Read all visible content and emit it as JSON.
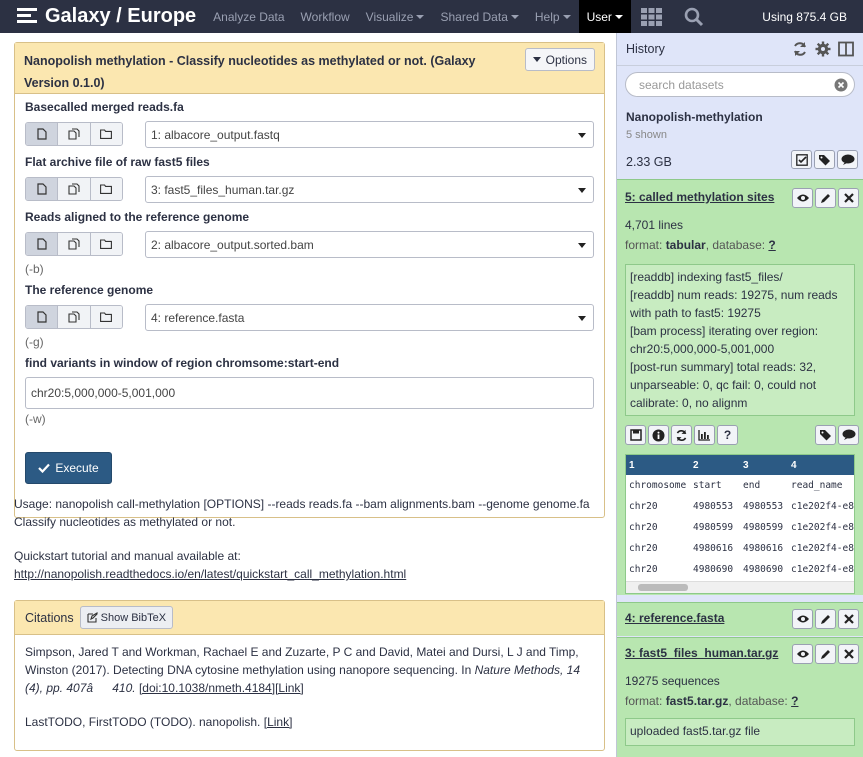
{
  "masthead": {
    "brand": "Galaxy / Europe",
    "nav": [
      "Analyze Data",
      "Workflow",
      "Visualize",
      "Shared Data",
      "Help",
      "User"
    ],
    "quota": "Using 875.4 GB"
  },
  "tool": {
    "title": "Nanopolish methylation - Classify nucleotides as methylated or not. (Galaxy Version 0.1.0)",
    "options_label": "Options",
    "params": [
      {
        "label": "Basecalled merged reads.fa",
        "value": "1: albacore_output.fastq",
        "hint": ""
      },
      {
        "label": "Flat archive file of raw fast5 files",
        "value": "3: fast5_files_human.tar.gz",
        "hint": ""
      },
      {
        "label": "Reads aligned to the reference genome",
        "value": "2: albacore_output.sorted.bam",
        "hint": "(-b)"
      },
      {
        "label": "The reference genome",
        "value": "4: reference.fasta",
        "hint": "(-g)"
      }
    ],
    "region": {
      "label": "find variants in window of region chromsome:start-end",
      "value": "chr20:5,000,000-5,001,000",
      "hint": "(-w)"
    },
    "execute_label": "Execute"
  },
  "help": {
    "usage": "Usage: nanopolish call-methylation [OPTIONS] --reads reads.fa --bam alignments.bam --genome genome.fa",
    "description": "Classify nucleotides as methylated or not.",
    "quickstart": "Quickstart tutorial and manual available at:",
    "link": "http://nanopolish.readthedocs.io/en/latest/quickstart_call_methylation.html"
  },
  "citations": {
    "title": "Citations",
    "bibtex_label": "Show BibTeX",
    "entry1_text": "Simpson, Jared T and Workman, Rachael E and Zuzarte, P C and David, Matei and Dursi, L J and Timp, Winston (2017). Detecting DNA cytosine methylation using nanopore sequencing. In ",
    "entry1_journal": "Nature Methods, 14 (4), pp. 407â410.",
    "entry1_doi": "[doi:10.1038/nmeth.4184]",
    "entry1_link": "[Link]",
    "entry2_text": "LastTODO, FirstTODO (TODO). nanopolish. ",
    "entry2_link": "[Link]"
  },
  "history": {
    "title": "History",
    "search_placeholder": "search datasets",
    "name": "Nanopolish-methylation",
    "shown": "5 shown",
    "size": "2.33 GB",
    "datasets": [
      {
        "title": "5: called methylation sites",
        "lines": "4,701 lines",
        "format_prefix": "format: ",
        "format": "tabular",
        "database_prefix": ", database: ",
        "database": "?",
        "peek": "[readdb] indexing fast5_files/\n[readdb] num reads: 19275, num reads with path to fast5: 19275\n[bam process] iterating over region: chr20:5,000,000-5,001,000\n[post-run summary] total reads: 32, unparseable: 0, qc fail: 0, could not calibrate: 0, no alignm",
        "table_head": [
          "1",
          "2",
          "3",
          "4"
        ],
        "table_rows": [
          [
            "chromosome",
            "start",
            "end",
            "read_name"
          ],
          [
            "chr20",
            "4980553",
            "4980553",
            "c1e202f4-e8"
          ],
          [
            "chr20",
            "4980599",
            "4980599",
            "c1e202f4-e8"
          ],
          [
            "chr20",
            "4980616",
            "4980616",
            "c1e202f4-e8"
          ],
          [
            "chr20",
            "4980690",
            "4980690",
            "c1e202f4-e8"
          ]
        ]
      },
      {
        "title": "4: reference.fasta"
      },
      {
        "title": "3: fast5_files_human.tar.gz",
        "lines": "19275 sequences",
        "format_prefix": "format: ",
        "format": "fast5.tar.gz",
        "database_prefix": ", database: ",
        "database": "?",
        "peek": "uploaded fast5.tar.gz file"
      }
    ]
  }
}
